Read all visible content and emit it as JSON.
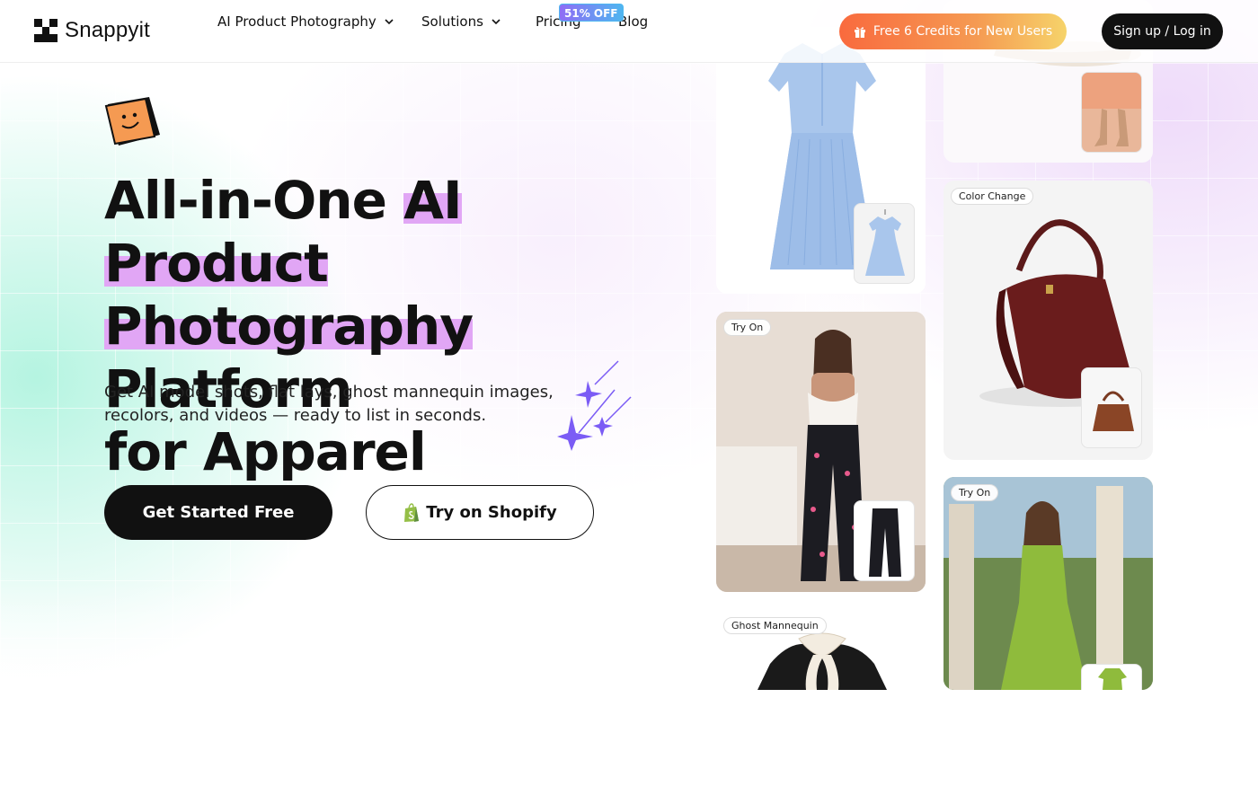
{
  "brand": {
    "name": "Snappyit"
  },
  "nav": {
    "items": [
      {
        "label": "AI Product Photography",
        "has_dropdown": true
      },
      {
        "label": "Solutions",
        "has_dropdown": true
      },
      {
        "label": "Pricing",
        "has_dropdown": false
      },
      {
        "label": "Blog",
        "has_dropdown": false
      }
    ],
    "pricing_badge": "51% OFF"
  },
  "header_actions": {
    "promo_label": "Free 6 Credits for New Users",
    "signup_label": "Sign up / Log in"
  },
  "hero": {
    "headline_part1": "All-in-One ",
    "headline_highlight1": "AI Product",
    "headline_highlight2": "Photography",
    "headline_part2": " Platform",
    "headline_part3": "for Apparel",
    "subtitle": "Get AI model shots, flat lays, ghost mannequin images, recolors, and videos — ready to list in seconds.",
    "cta_primary": "Get Started Free",
    "cta_secondary": "Try on Shopify"
  },
  "gallery": {
    "tags": {
      "color_change": "Color Change",
      "try_on_1": "Try On",
      "try_on_2": "Try On",
      "ghost_mannequin": "Ghost Mannequin"
    }
  },
  "colors": {
    "accent_highlight": "#e1a6f5",
    "promo_gradient_start": "#f96a3e",
    "promo_gradient_end": "#f6d36a",
    "badge_gradient_start": "#8f6cf5",
    "badge_gradient_end": "#4fb6f0",
    "sparkle": "#7b5cf5",
    "mascot_orange": "#f59a52"
  },
  "icons": [
    "chevron-down-icon",
    "gift-icon",
    "shopify-icon",
    "sparkle-icon",
    "mascot-cube-icon"
  ]
}
